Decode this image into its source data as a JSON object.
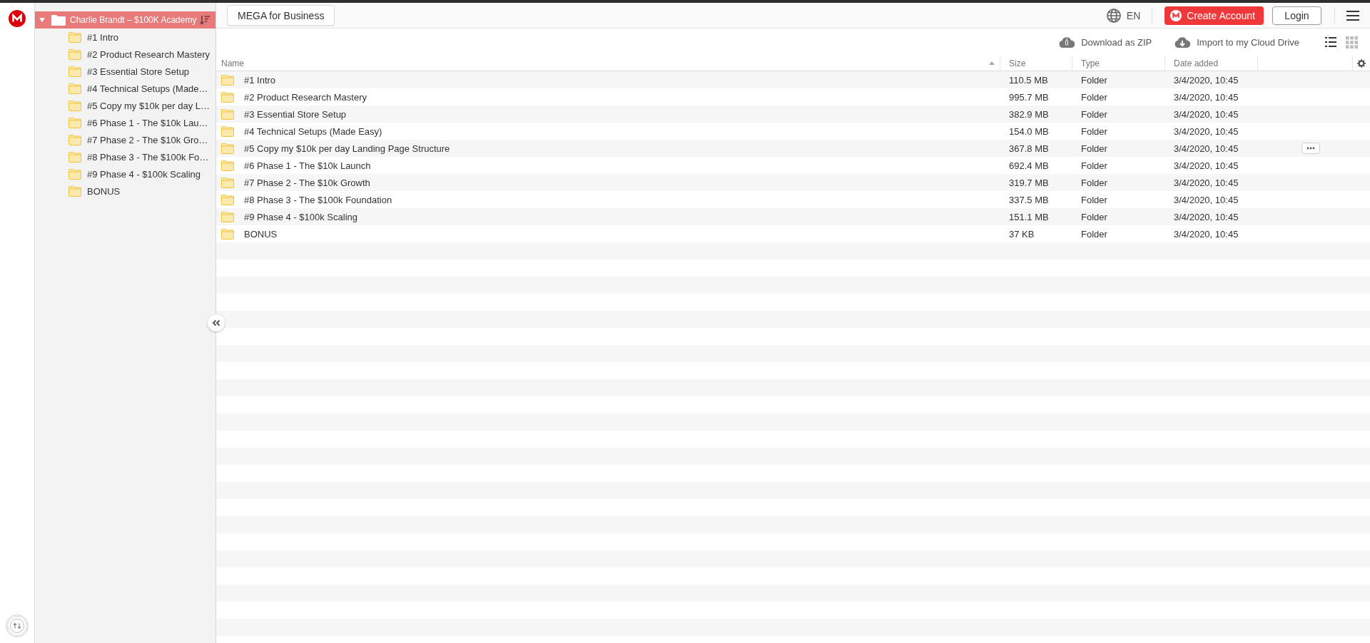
{
  "sidebar": {
    "root": {
      "label": "Charlie Brandt – $100K Academy",
      "selected": true,
      "expanded": true,
      "children": [
        {
          "label": "#1 Intro"
        },
        {
          "label": "#2 Product Research Mastery"
        },
        {
          "label": "#3 Essential Store Setup"
        },
        {
          "label": "#4 Technical Setups (Made…"
        },
        {
          "label": "#5 Copy my $10k per day L…"
        },
        {
          "label": "#6 Phase 1 - The $10k Lau…"
        },
        {
          "label": "#7 Phase 2 - The $10k Gro…"
        },
        {
          "label": "#8 Phase 3 - The $100k Fo…"
        },
        {
          "label": "#9 Phase 4 - $100k Scaling"
        },
        {
          "label": "BONUS"
        }
      ]
    }
  },
  "top_bar": {
    "business_button": "MEGA for Business",
    "language": "EN",
    "create_account_button": "Create Account",
    "login_button": "Login"
  },
  "toolbar": {
    "actions": [
      {
        "kind": "zip",
        "label": "Download as ZIP"
      },
      {
        "kind": "import",
        "label": "Import to my Cloud Drive"
      }
    ],
    "view_modes": [
      {
        "kind": "list",
        "selected": true
      },
      {
        "kind": "grid",
        "selected": false
      }
    ]
  },
  "table": {
    "columns": [
      {
        "label": "Name",
        "sorted": true
      },
      {
        "label": "Size",
        "sorted": false
      },
      {
        "label": "Type",
        "sorted": false
      },
      {
        "label": "Date added",
        "sorted": false
      }
    ],
    "rows": [
      {
        "name": "#1 Intro",
        "size": "110.5 MB",
        "type": "Folder",
        "date": "3/4/2020, 10:45",
        "hovered": false
      },
      {
        "name": "#2 Product Research Mastery",
        "size": "995.7 MB",
        "type": "Folder",
        "date": "3/4/2020, 10:45",
        "hovered": false
      },
      {
        "name": "#3 Essential Store Setup",
        "size": "382.9 MB",
        "type": "Folder",
        "date": "3/4/2020, 10:45",
        "hovered": false
      },
      {
        "name": "#4 Technical Setups (Made Easy)",
        "size": "154.0 MB",
        "type": "Folder",
        "date": "3/4/2020, 10:45",
        "hovered": false
      },
      {
        "name": "#5 Copy my $10k per day Landing Page Structure",
        "size": "367.8 MB",
        "type": "Folder",
        "date": "3/4/2020, 10:45",
        "hovered": true
      },
      {
        "name": "#6 Phase 1 - The $10k Launch",
        "size": "692.4 MB",
        "type": "Folder",
        "date": "3/4/2020, 10:45",
        "hovered": false
      },
      {
        "name": "#7 Phase 2 - The $10k Growth",
        "size": "319.7 MB",
        "type": "Folder",
        "date": "3/4/2020, 10:45",
        "hovered": false
      },
      {
        "name": "#8 Phase 3 - The $100k Foundation",
        "size": "337.5 MB",
        "type": "Folder",
        "date": "3/4/2020, 10:45",
        "hovered": false
      },
      {
        "name": "#9 Phase 4 - $100k Scaling",
        "size": "151.1 MB",
        "type": "Folder",
        "date": "3/4/2020, 10:45",
        "hovered": false
      },
      {
        "name": "BONUS",
        "size": "37 KB",
        "type": "Folder",
        "date": "3/4/2020, 10:45",
        "hovered": false
      }
    ]
  }
}
